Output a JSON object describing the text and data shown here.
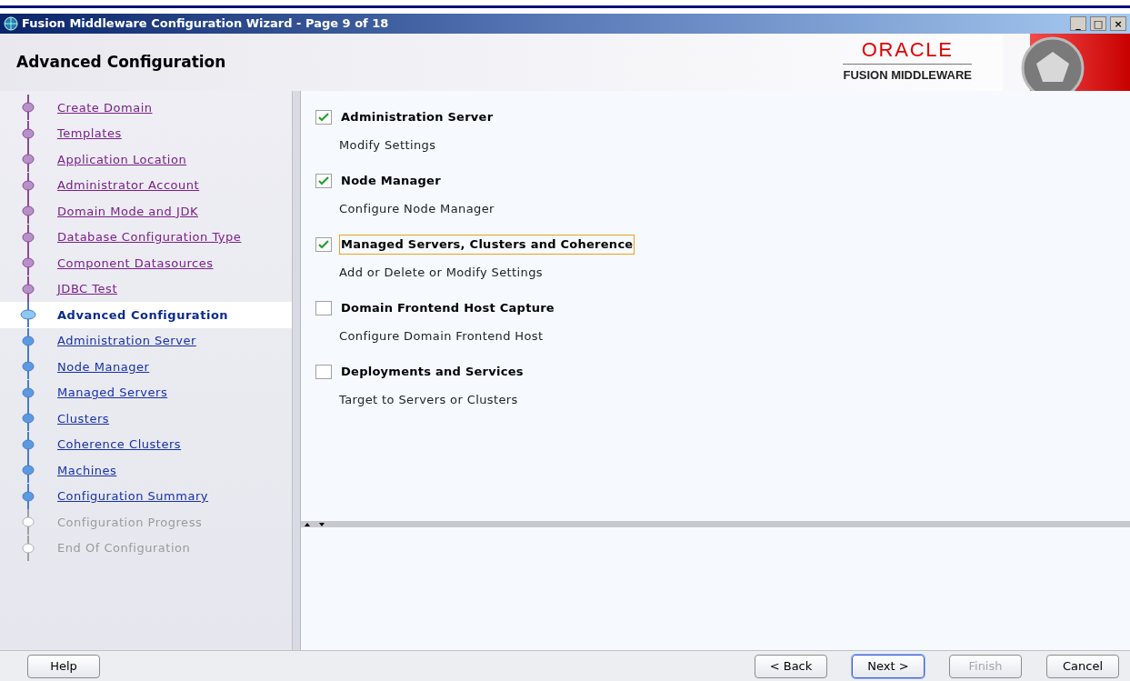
{
  "window": {
    "title": "Fusion Middleware Configuration Wizard - Page 9 of 18",
    "controls": [
      "_",
      "□",
      "×"
    ]
  },
  "header": {
    "title": "Advanced Configuration",
    "logo": {
      "brand": "ORACLE",
      "product": "FUSION MIDDLEWARE"
    }
  },
  "steps": [
    {
      "label": "Create Domain",
      "kind": "done",
      "selected": false
    },
    {
      "label": "Templates",
      "kind": "done",
      "selected": false
    },
    {
      "label": "Application Location",
      "kind": "done",
      "selected": false
    },
    {
      "label": "Administrator Account",
      "kind": "done",
      "selected": false
    },
    {
      "label": "Domain Mode and JDK",
      "kind": "done",
      "selected": false
    },
    {
      "label": "Database Configuration Type",
      "kind": "done",
      "selected": false
    },
    {
      "label": "Component Datasources",
      "kind": "done",
      "selected": false
    },
    {
      "label": "JDBC Test",
      "kind": "done",
      "selected": false
    },
    {
      "label": "Advanced Configuration",
      "kind": "current",
      "selected": true
    },
    {
      "label": "Administration Server",
      "kind": "todo",
      "selected": false
    },
    {
      "label": "Node Manager",
      "kind": "todo",
      "selected": false
    },
    {
      "label": "Managed Servers",
      "kind": "todo",
      "selected": false
    },
    {
      "label": "Clusters",
      "kind": "todo",
      "selected": false
    },
    {
      "label": "Coherence Clusters",
      "kind": "todo",
      "selected": false
    },
    {
      "label": "Machines",
      "kind": "todo",
      "selected": false
    },
    {
      "label": "Configuration Summary",
      "kind": "todo",
      "selected": false
    },
    {
      "label": "Configuration Progress",
      "kind": "locked",
      "selected": false
    },
    {
      "label": "End Of Configuration",
      "kind": "locked",
      "selected": false
    }
  ],
  "options": [
    {
      "label": "Administration Server",
      "description": "Modify Settings",
      "checked": true,
      "focused": false
    },
    {
      "label": "Node Manager",
      "description": "Configure Node Manager",
      "checked": true,
      "focused": false
    },
    {
      "label": "Managed Servers, Clusters and Coherence",
      "description": "Add or Delete or Modify Settings",
      "checked": true,
      "focused": true
    },
    {
      "label": "Domain Frontend Host Capture",
      "description": "Configure Domain Frontend Host",
      "checked": false,
      "focused": false
    },
    {
      "label": "Deployments and Services",
      "description": "Target to Servers or Clusters",
      "checked": false,
      "focused": false
    }
  ],
  "buttons": {
    "left": [
      {
        "label": "Help",
        "disabled": false,
        "default": false
      }
    ],
    "right": [
      {
        "label": "< Back",
        "disabled": false,
        "default": false
      },
      {
        "label": "Next >",
        "disabled": false,
        "default": true
      },
      {
        "label": "Finish",
        "disabled": true,
        "default": false
      },
      {
        "label": "Cancel",
        "disabled": false,
        "default": false
      }
    ]
  }
}
